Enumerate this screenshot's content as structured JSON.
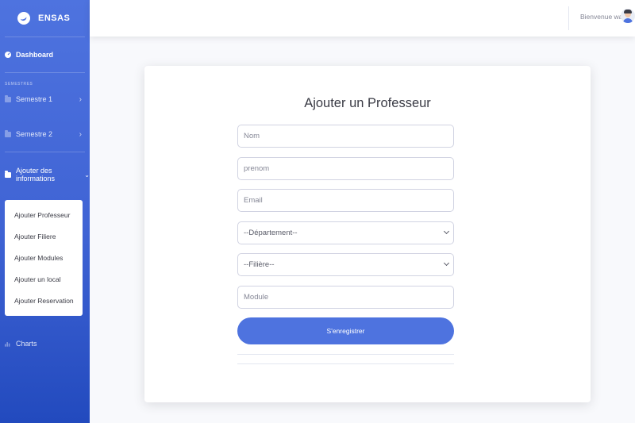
{
  "sidebar": {
    "brand": "ENSAS",
    "dashboard": "Dashboard",
    "section_heading": "SEMESTRES",
    "semestre1": "Semestre 1",
    "semestre2": "Semestre 2",
    "ajouter_infos": "Ajouter des informations",
    "submenu": [
      "Ajouter Professeur",
      "Ajouter Filiere",
      "Ajouter Modules",
      "Ajouter un local",
      "Ajouter Reservation"
    ],
    "charts": "Charts"
  },
  "topbar": {
    "welcome": "Bienvenue walid"
  },
  "form": {
    "title": "Ajouter un Professeur",
    "nom_placeholder": "Nom",
    "prenom_placeholder": "prenom",
    "email_placeholder": "Email",
    "departement_selected": "--Département--",
    "filiere_selected": "--Filière--",
    "module_placeholder": "Module",
    "submit_label": "S'enregistrer"
  },
  "colors": {
    "primary": "#4e73df",
    "sidebar_dark": "#224abe",
    "page_bg": "#f8f9fc"
  }
}
